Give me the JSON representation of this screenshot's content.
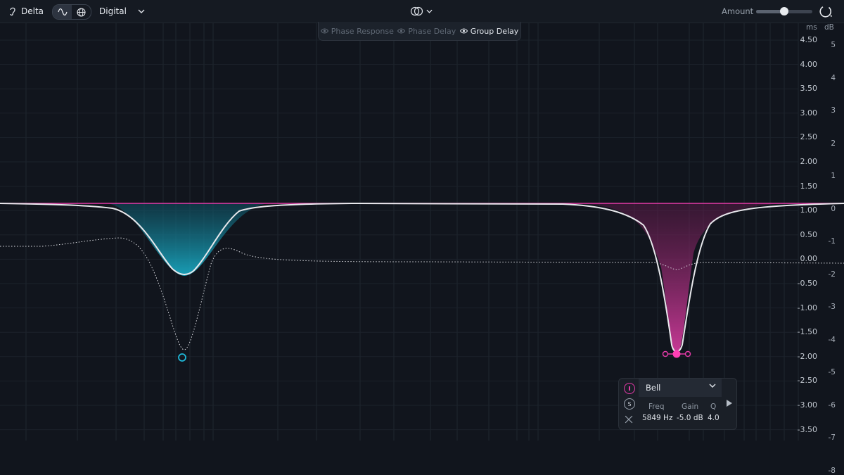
{
  "toolbar": {
    "delta_label": "Delta",
    "mode_label": "Digital",
    "amount_label": "Amount",
    "amount_value": 0.5,
    "icons": [
      "ear-icon",
      "waveform-icon",
      "globe-icon",
      "chevron-down-icon",
      "stereo-link-icon",
      "power-icon"
    ]
  },
  "tabs": [
    {
      "label": "Phase Response",
      "active": false
    },
    {
      "label": "Phase Delay",
      "active": false
    },
    {
      "label": "Group Delay",
      "active": true
    }
  ],
  "axis": {
    "ms_unit": "ms",
    "db_unit": "dB",
    "ms_labels": [
      "4.50",
      "4.00",
      "3.50",
      "3.00",
      "2.50",
      "2.00",
      "1.50",
      "1.00",
      "0.50",
      "0.00",
      "-0.50",
      "-1.00",
      "-1.50",
      "-2.00",
      "-2.50",
      "-3.00",
      "-3.50"
    ],
    "db_labels": [
      "5",
      "4",
      "3",
      "2",
      "1",
      "0",
      "-1",
      "-2",
      "-3",
      "-4",
      "-5",
      "-6",
      "-7",
      "-8"
    ]
  },
  "band_panel": {
    "type": "Bell",
    "freq_label": "Freq",
    "gain_label": "Gain",
    "q_label": "Q",
    "freq_value": "5849 Hz",
    "gain_value": "-5.0 dB",
    "q_value": "4.0",
    "solo_label": "S"
  },
  "colors": {
    "band1": "#1fb8d8",
    "band2": "#e43aa8",
    "curve": "#e8e8ec",
    "background": "#11151d"
  }
}
